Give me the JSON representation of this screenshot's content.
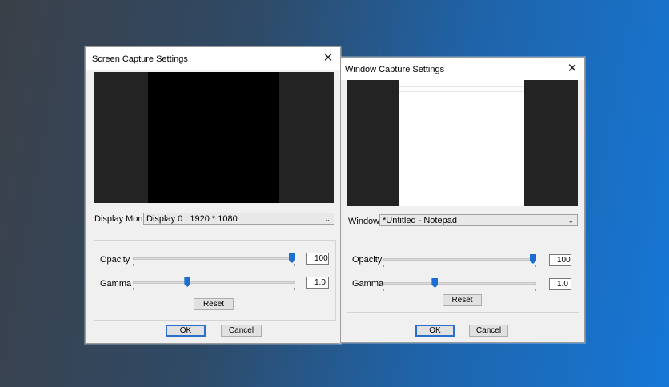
{
  "screen_dialog": {
    "title": "Screen Capture Settings",
    "close_glyph": "✕",
    "monitor_label": "Display Monitor:",
    "monitor_value": "Display 0 : 1920 * 1080",
    "opacity_label": "Opacity",
    "opacity_value": "100",
    "opacity_level": 1.0,
    "gamma_label": "Gamma",
    "gamma_value": "1.0",
    "gamma_level": 0.33,
    "reset_label": "Reset",
    "ok_label": "OK",
    "cancel_label": "Cancel"
  },
  "window_dialog": {
    "title": "Window Capture Settings",
    "close_glyph": "✕",
    "window_label": "Window:",
    "window_value": "*Untitled - Notepad",
    "opacity_label": "Opacity",
    "opacity_value": "100",
    "opacity_level": 1.0,
    "gamma_label": "Gamma",
    "gamma_value": "1.0",
    "gamma_level": 0.33,
    "reset_label": "Reset",
    "ok_label": "OK",
    "cancel_label": "Cancel"
  },
  "icons": {
    "close": "close-icon",
    "dropdown": "chevron-down-icon"
  },
  "colors": {
    "accent": "#1c6fd1"
  }
}
